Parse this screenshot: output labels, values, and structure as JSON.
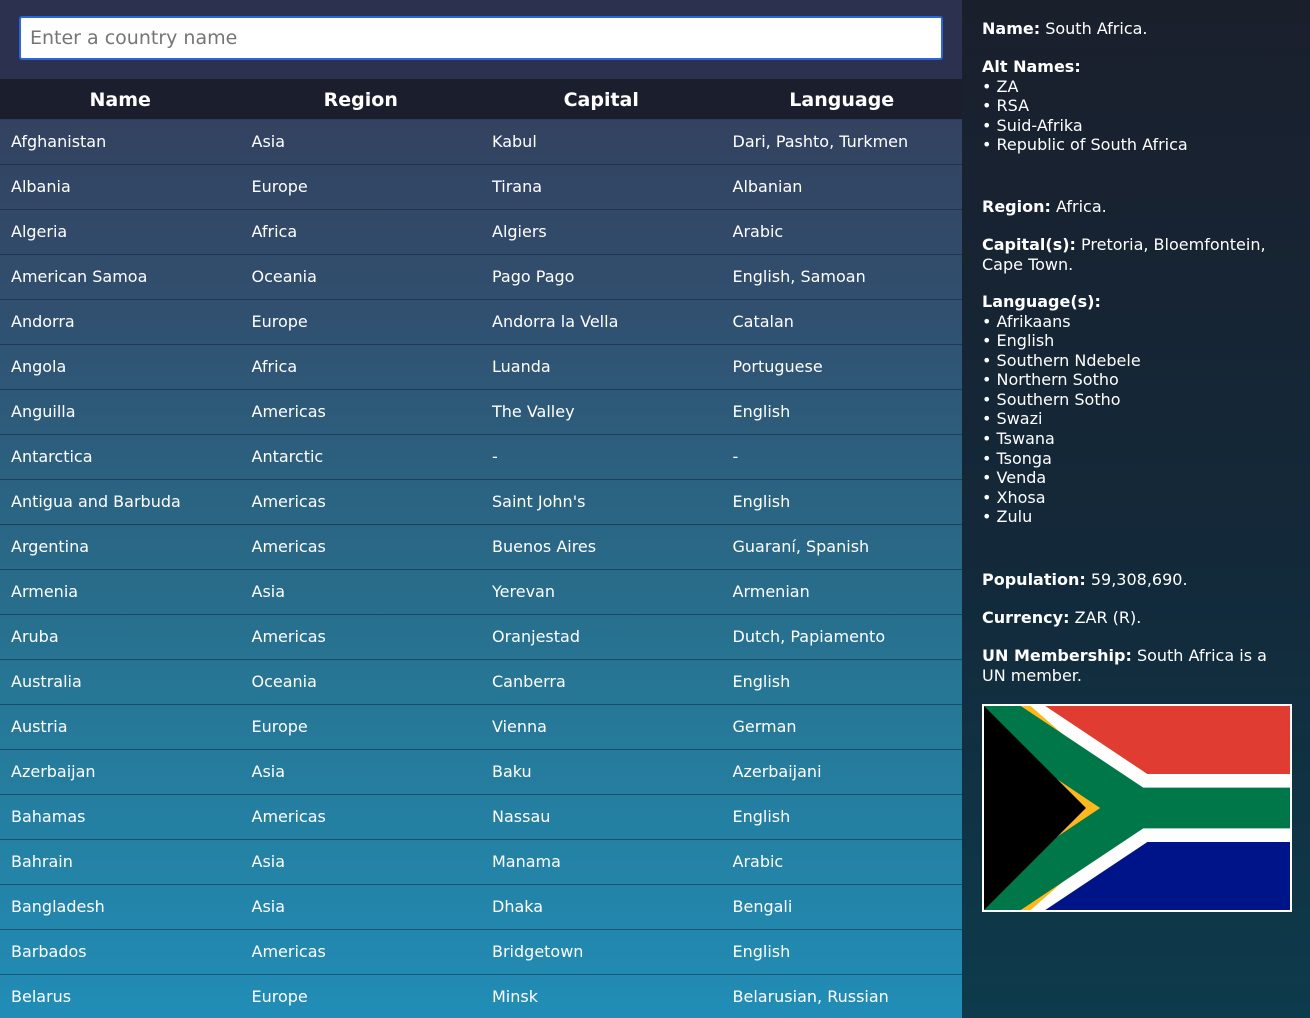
{
  "search": {
    "placeholder": "Enter a country name",
    "value": ""
  },
  "table": {
    "headers": [
      "Name",
      "Region",
      "Capital",
      "Language"
    ],
    "rows": [
      [
        "Afghanistan",
        "Asia",
        "Kabul",
        "Dari, Pashto, Turkmen"
      ],
      [
        "Albania",
        "Europe",
        "Tirana",
        "Albanian"
      ],
      [
        "Algeria",
        "Africa",
        "Algiers",
        "Arabic"
      ],
      [
        "American Samoa",
        "Oceania",
        "Pago Pago",
        "English, Samoan"
      ],
      [
        "Andorra",
        "Europe",
        "Andorra la Vella",
        "Catalan"
      ],
      [
        "Angola",
        "Africa",
        "Luanda",
        "Portuguese"
      ],
      [
        "Anguilla",
        "Americas",
        "The Valley",
        "English"
      ],
      [
        "Antarctica",
        "Antarctic",
        "-",
        "-"
      ],
      [
        "Antigua and Barbuda",
        "Americas",
        "Saint John's",
        "English"
      ],
      [
        "Argentina",
        "Americas",
        "Buenos Aires",
        "Guaraní, Spanish"
      ],
      [
        "Armenia",
        "Asia",
        "Yerevan",
        "Armenian"
      ],
      [
        "Aruba",
        "Americas",
        "Oranjestad",
        "Dutch, Papiamento"
      ],
      [
        "Australia",
        "Oceania",
        "Canberra",
        "English"
      ],
      [
        "Austria",
        "Europe",
        "Vienna",
        "German"
      ],
      [
        "Azerbaijan",
        "Asia",
        "Baku",
        "Azerbaijani"
      ],
      [
        "Bahamas",
        "Americas",
        "Nassau",
        "English"
      ],
      [
        "Bahrain",
        "Asia",
        "Manama",
        "Arabic"
      ],
      [
        "Bangladesh",
        "Asia",
        "Dhaka",
        "Bengali"
      ],
      [
        "Barbados",
        "Americas",
        "Bridgetown",
        "English"
      ],
      [
        "Belarus",
        "Europe",
        "Minsk",
        "Belarusian, Russian"
      ]
    ]
  },
  "details": {
    "name_label": "Name:",
    "name_value": "South Africa.",
    "alt_names_label": "Alt Names:",
    "alt_names": [
      "ZA",
      "RSA",
      "Suid-Afrika",
      "Republic of South Africa"
    ],
    "region_label": "Region:",
    "region_value": "Africa.",
    "capitals_label": "Capital(s):",
    "capitals_value": "Pretoria, Bloemfontein, Cape Town.",
    "languages_label": "Language(s):",
    "languages": [
      "Afrikaans",
      "English",
      "Southern Ndebele",
      "Northern Sotho",
      "Southern Sotho",
      "Swazi",
      "Tswana",
      "Tsonga",
      "Venda",
      "Xhosa",
      "Zulu"
    ],
    "population_label": "Population:",
    "population_value": "59,308,690.",
    "currency_label": "Currency:",
    "currency_value": "ZAR (R).",
    "un_label": "UN Membership:",
    "un_value": "South Africa is a UN member.",
    "flag_icon": "south-africa-flag"
  },
  "colors": {
    "flag_red": "#e03c31",
    "flag_blue": "#001489",
    "flag_green": "#007749",
    "flag_gold": "#ffb81c",
    "flag_black": "#000000",
    "search_border": "#2a66d9"
  }
}
